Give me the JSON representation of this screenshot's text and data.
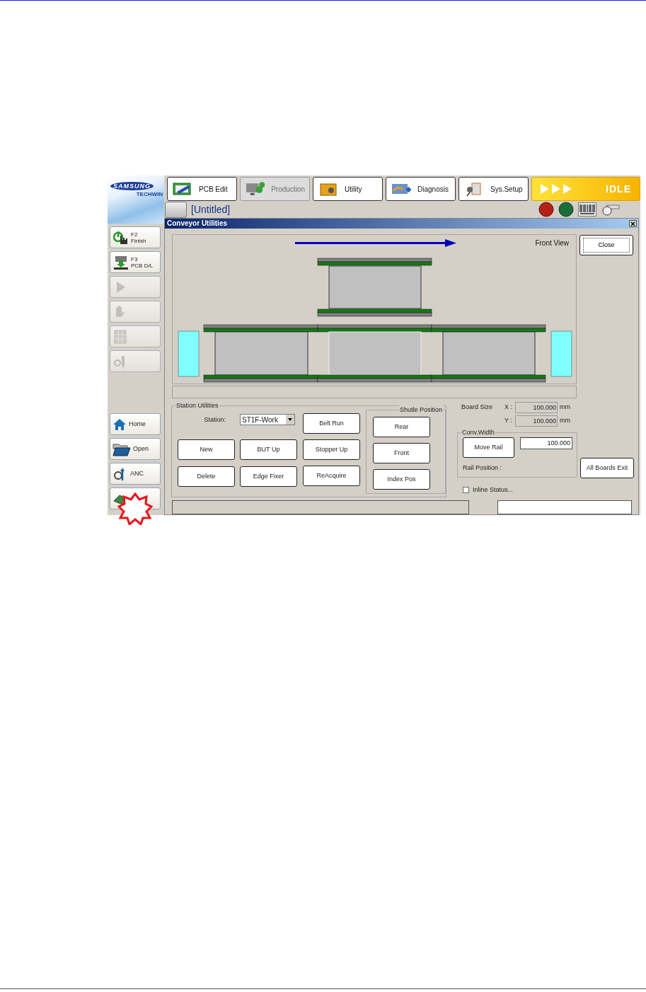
{
  "logo": {
    "brand": "SAMSUNG",
    "sub": "TECHWIN"
  },
  "side_buttons": [
    {
      "key": "F2",
      "label": "Finish",
      "disabled": false
    },
    {
      "key": "F3",
      "label": "PCB D/L",
      "disabled": false
    },
    {
      "disabled": true
    },
    {
      "disabled": true
    },
    {
      "disabled": true
    },
    {
      "disabled": true
    }
  ],
  "nav_buttons": [
    {
      "label": "Home"
    },
    {
      "label": "Open"
    },
    {
      "label": "ANC"
    }
  ],
  "tabs": [
    {
      "label": "PCB Edit",
      "selected": false
    },
    {
      "label": "Production",
      "selected": true
    },
    {
      "label": "Utility",
      "selected": false
    },
    {
      "label": "Diagnosis",
      "selected": false
    },
    {
      "label": "Sys.Setup",
      "selected": false
    }
  ],
  "status": {
    "text": "IDLE"
  },
  "document": {
    "title": "[Untitled]"
  },
  "dialog": {
    "title": "Conveyor Utilities",
    "view_label": "Front View",
    "close_button": "Close",
    "station_utilities": {
      "title": "Station Utilities",
      "station_label": "Station:",
      "station_value": "ST1F-Work",
      "buttons": [
        "Belt Run",
        "New",
        "BUT Up",
        "Stopper Up",
        "Delete",
        "Edge Fixer",
        "ReAcquire"
      ]
    },
    "shuttle_position": {
      "title": "Shutle Position",
      "buttons": [
        "Rear",
        "Front",
        "Index Pos"
      ]
    },
    "board_size": {
      "label": "Board Size",
      "x_label": "X :",
      "x_value": "100.000",
      "x_unit": "mm",
      "y_label": "Y :",
      "y_value": "100.000",
      "y_unit": "mm"
    },
    "conv_width": {
      "title": "Conv.Width",
      "button": "Move Rail",
      "value": "100.000",
      "rail_position_label": "Rail Position :"
    },
    "all_boards_exit": "All Boards Exit",
    "inline_status": {
      "label": "Inline Status...",
      "checked": false
    }
  }
}
